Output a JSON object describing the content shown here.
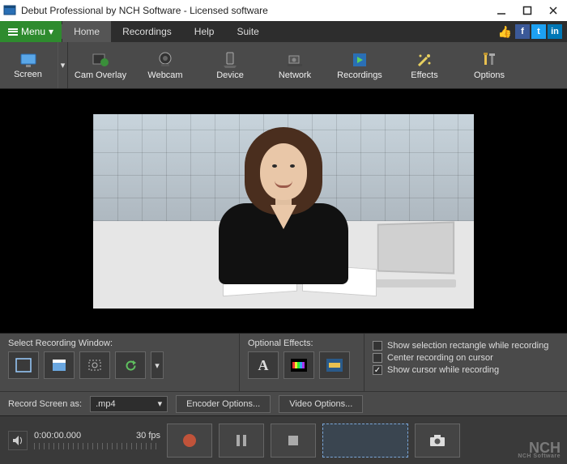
{
  "title": "Debut Professional by NCH Software - Licensed software",
  "menubar": {
    "menu_label": "Menu",
    "items": [
      "Home",
      "Recordings",
      "Help",
      "Suite"
    ],
    "active_index": 0
  },
  "toolbar": [
    {
      "label": "Screen",
      "icon": "monitor-icon"
    },
    {
      "label": "Cam Overlay",
      "icon": "cam-overlay-icon"
    },
    {
      "label": "Webcam",
      "icon": "webcam-icon"
    },
    {
      "label": "Device",
      "icon": "device-icon"
    },
    {
      "label": "Network",
      "icon": "network-icon"
    },
    {
      "label": "Recordings",
      "icon": "recordings-icon"
    },
    {
      "label": "Effects",
      "icon": "effects-icon"
    },
    {
      "label": "Options",
      "icon": "options-icon"
    }
  ],
  "options_panel": {
    "select_window_label": "Select Recording Window:",
    "optional_effects_label": "Optional Effects:",
    "checkbox_show_selection": "Show selection rectangle while recording",
    "checkbox_center_cursor": "Center recording on cursor",
    "checkbox_show_cursor": "Show cursor while recording",
    "show_cursor_checked": true
  },
  "record_strip": {
    "label": "Record Screen as:",
    "format": ".mp4",
    "encoder_btn": "Encoder Options...",
    "video_btn": "Video Options..."
  },
  "controls": {
    "timecode": "0:00:00.000",
    "fps": "30 fps"
  },
  "logo": {
    "brand": "NCH",
    "sub": "NCH Software"
  }
}
